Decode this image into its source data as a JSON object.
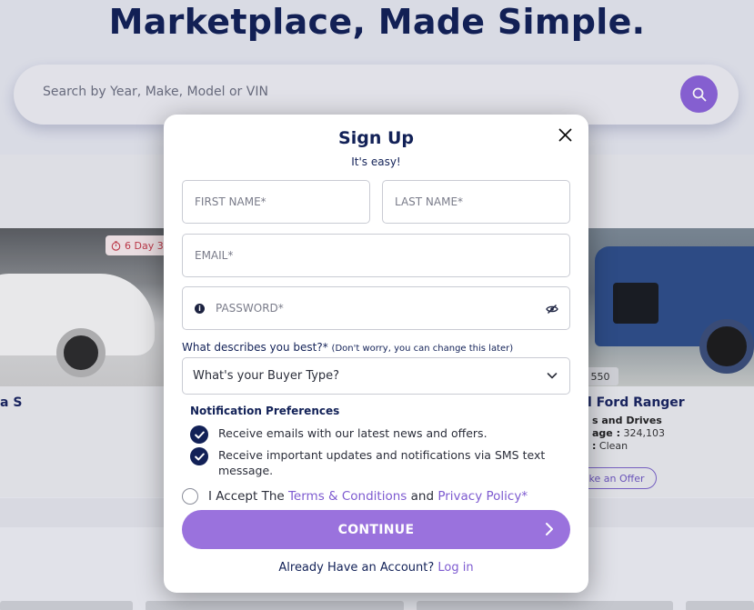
{
  "page": {
    "hero_title": "Marketplace, Made Simple.",
    "search": {
      "placeholder": "Search by Year, Make, Model or VIN",
      "button_icon": "search-icon"
    }
  },
  "listings": {
    "left_card": {
      "timer": "6 Day 3",
      "title": "a S"
    },
    "right_card": {
      "price_chip": "550",
      "title": "l Ford Ranger",
      "line1": "s and Drives",
      "line2_label": "age :",
      "line2_value": "324,103",
      "line3_label": ":",
      "line3_value": "Clean",
      "offer_button": "ke an Offer"
    }
  },
  "modal": {
    "title": "Sign Up",
    "subtitle": "It's easy!",
    "fields": {
      "first_name_placeholder": "FIRST NAME*",
      "last_name_placeholder": "LAST NAME*",
      "email_placeholder": "EMAIL*",
      "password_placeholder": "PASSWORD*"
    },
    "describe_label": "What describes you best?*",
    "describe_hint": "(Don't worry, you can change this later)",
    "buyer_type_select": "What's your Buyer Type?",
    "notification_title": "Notification Preferences",
    "notifications": [
      {
        "label": "Receive emails with our latest news and offers.",
        "checked": true
      },
      {
        "label": "Receive important updates and notifications via SMS text message.",
        "checked": true
      }
    ],
    "accept": {
      "prefix": "I Accept The",
      "terms_link": "Terms & Conditions",
      "and": "and",
      "privacy_link": "Privacy Policy*",
      "checked": false
    },
    "continue_button": "CONTINUE",
    "login_prompt": "Already Have an Account?",
    "login_link": "Log in"
  },
  "colors": {
    "navy": "#122157",
    "accent_purple": "#9a72dd",
    "link_purple": "#7d5ad0"
  }
}
